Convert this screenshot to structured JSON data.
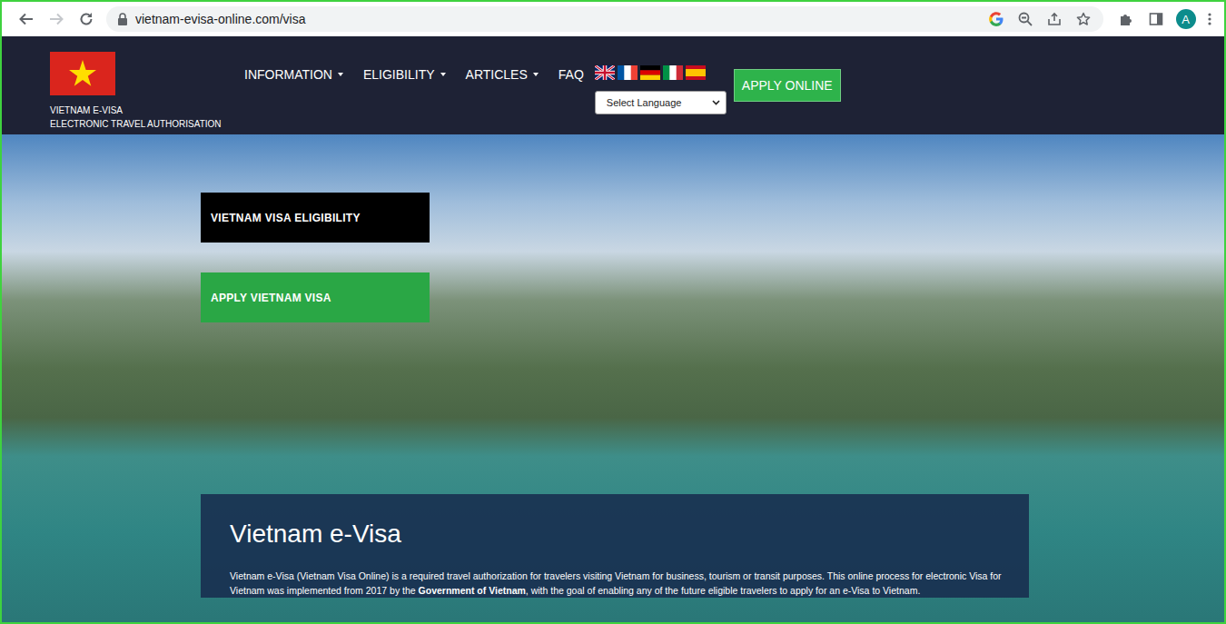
{
  "browser": {
    "url": "vietnam-evisa-online.com/visa",
    "back_enabled": true,
    "forward_enabled": false,
    "profile_initial": "A"
  },
  "site": {
    "logo_line1": "VIETNAM E-VISA",
    "logo_line2": "ELECTRONIC TRAVEL AUTHORISATION",
    "nav": [
      {
        "label": "INFORMATION",
        "dropdown": true
      },
      {
        "label": "ELIGIBILITY",
        "dropdown": true
      },
      {
        "label": "ARTICLES",
        "dropdown": true
      },
      {
        "label": "FAQ",
        "dropdown": false
      }
    ],
    "language_select": "Select Language",
    "apply_button": "APPLY ONLINE"
  },
  "hero": {
    "buttons": [
      {
        "label": "VIETNAM VISA ELIGIBILITY",
        "color": "#000000"
      },
      {
        "label": "APPLY VIETNAM VISA",
        "color": "#2aa745"
      }
    ],
    "title": "Vietnam e-Visa",
    "paragraph": [
      {
        "text": "Vietnam e-Visa (Vietnam Visa Online) is a required travel authorization for travelers visiting Vietnam for business, tourism or transit purposes. This online process for electronic Visa for Vietnam was implemented from 2017 by the ",
        "bold": false
      },
      {
        "text": "Government of Vietnam",
        "bold": true
      },
      {
        "text": ", with the goal of enabling any of the future eligible travelers to apply for an e-Visa to Vietnam.",
        "bold": false
      }
    ]
  }
}
